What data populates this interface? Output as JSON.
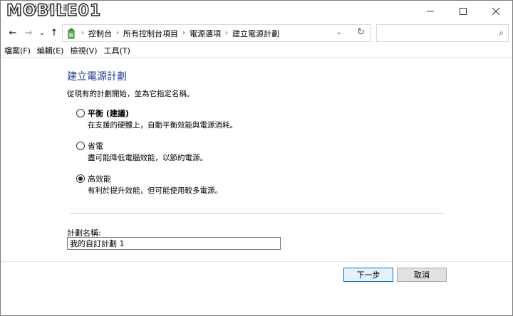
{
  "window": {
    "title": "建立電源計劃",
    "watermark": "MOBILE01"
  },
  "title_controls": {
    "minimize_icon": "minimize-icon",
    "maximize_icon": "maximize-icon",
    "close_icon": "close-icon"
  },
  "nav": {
    "back": "←",
    "forward": "→",
    "recent": "⌄",
    "up": "↑",
    "breadcrumbs": [
      "控制台",
      "所有控制台項目",
      "電源選項",
      "建立電源計劃"
    ],
    "separator": "›",
    "dropdown": "⌄",
    "refresh": "↻",
    "search_value": "",
    "search_icon": "⌕"
  },
  "menu": {
    "items": [
      "檔案(F)",
      "編輯(E)",
      "檢視(V)",
      "工具(T)"
    ]
  },
  "main": {
    "heading": "建立電源計劃",
    "intro": "從現有的計劃開始，並為它指定名稱。",
    "plans": [
      {
        "label": "平衡 (建議)",
        "description": "在支援的硬體上，自動平衡效能與電源消耗。",
        "checked": false,
        "bold": true
      },
      {
        "label": "省電",
        "description": "盡可能降低電腦效能，以節約電源。",
        "checked": false,
        "bold": false
      },
      {
        "label": "高效能",
        "description": "有利於提升效能，但可能使用較多電源。",
        "checked": true,
        "bold": false
      }
    ],
    "name_label": "計劃名稱:",
    "name_value": "我的自訂計劃 1"
  },
  "buttons": {
    "next": "下一步",
    "cancel": "取消"
  },
  "colors": {
    "heading": "#1e3d8f",
    "primary_border": "#0078d7"
  }
}
